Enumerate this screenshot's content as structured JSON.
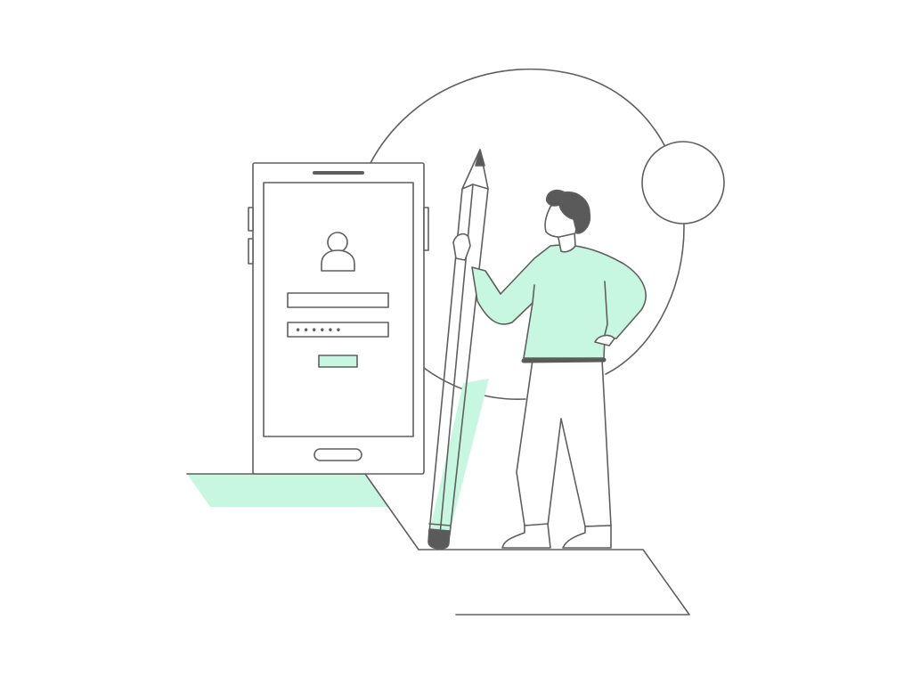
{
  "illustration": {
    "login_screen": {
      "password_mask": "••••••"
    }
  },
  "colors": {
    "stroke": "#5f5f5f",
    "accent": "#c8f7e1",
    "dark": "#5a5a5a",
    "background": "#ffffff"
  },
  "icons": [
    "user-avatar-icon",
    "pencil-icon",
    "person-figure"
  ]
}
